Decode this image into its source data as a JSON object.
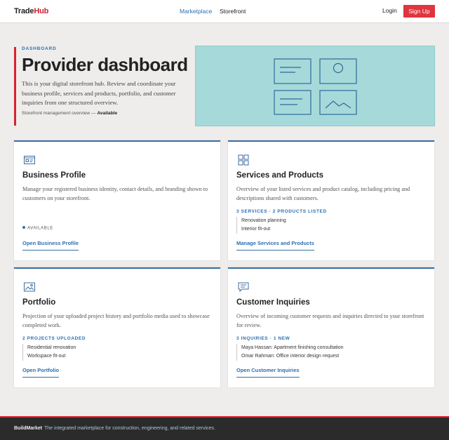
{
  "header": {
    "logo_part1": "Trade",
    "logo_part2": "Hub",
    "nav": [
      "Marketplace",
      "Storefront"
    ],
    "login": "Login",
    "signup": "Sign Up",
    "accent_color": "#e0353f",
    "link_color": "#2c6fb3"
  },
  "hero": {
    "eyebrow": "DASHBOARD",
    "title": "Provider dashboard",
    "description": "This is your digital storefront hub. Review and coordinate your business profile, services and products, portfolio, and customer inquiries from one structured overview.",
    "meta_label": "Storefront management overview —",
    "meta_status": "Available",
    "illustration_color": "#a6dada"
  },
  "cards": [
    {
      "icon": "id-card-icon",
      "title": "Business Profile",
      "description": "Manage your registered business identity, contact details, and branding shown to customers on your storefront.",
      "status": "AVAILABLE",
      "link": "Open Business Profile"
    },
    {
      "icon": "grid-icon",
      "title": "Services and Products",
      "description": "Overview of your listed services and product catalog, including pricing and descriptions shared with customers.",
      "count": "3 SERVICES · 2 PRODUCTS LISTED",
      "items": [
        "Renovation planning",
        "Interior fit-out"
      ],
      "link": "Manage Services and Products"
    },
    {
      "icon": "image-icon",
      "title": "Portfolio",
      "description": "Projection of your uploaded project history and portfolio media used to showcase completed work.",
      "count": "2 PROJECTS UPLOADED",
      "items": [
        "Residential renovation",
        "Workspace fit-out"
      ],
      "link": "Open Portfolio"
    },
    {
      "icon": "message-icon",
      "title": "Customer Inquiries",
      "description": "Overview of incoming customer requests and inquiries directed to your storefront for review.",
      "count": "3 INQUIRIES · 1 NEW",
      "items": [
        "Maya Hassan: Apartment finishing consultation",
        "Omar Rahman: Office interior design request"
      ],
      "link": "Open Customer Inquiries"
    }
  ],
  "footer": {
    "brand": "BuildMarket",
    "tagline": "The integrated marketplace for construction, engineering, and related services."
  }
}
